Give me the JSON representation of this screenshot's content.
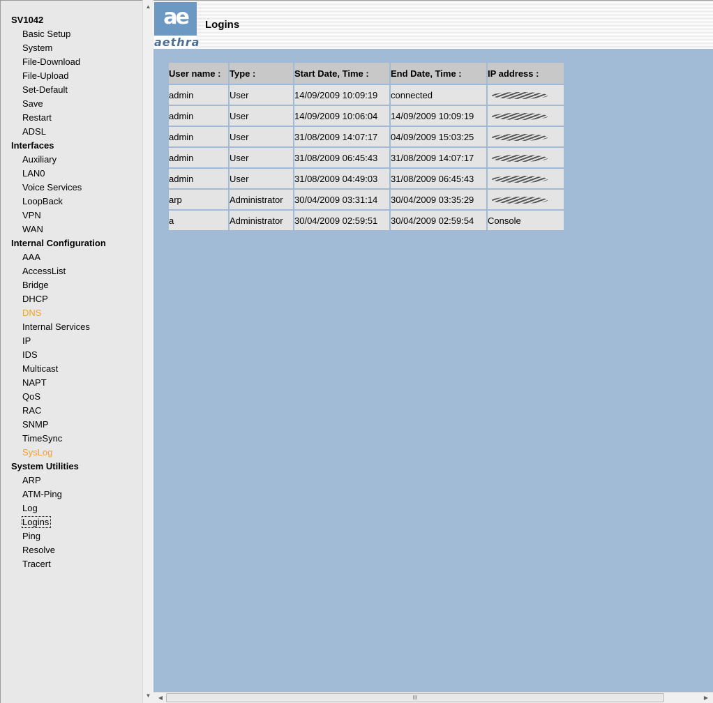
{
  "nav": {
    "groups": [
      {
        "title": "SV1042",
        "items": [
          "Basic Setup",
          "System",
          "File-Download",
          "File-Upload",
          "Set-Default",
          "Save",
          "Restart",
          "ADSL"
        ]
      },
      {
        "title": "Interfaces",
        "items": [
          "Auxiliary",
          "LAN0",
          "Voice Services",
          "LoopBack",
          "VPN",
          "WAN"
        ]
      },
      {
        "title": "Internal Configuration",
        "items": [
          "AAA",
          "AccessList",
          "Bridge",
          "DHCP",
          "DNS",
          "Internal Services",
          "IP",
          "IDS",
          "Multicast",
          "NAPT",
          "QoS",
          "RAC",
          "SNMP",
          "TimeSync",
          "SysLog"
        ]
      },
      {
        "title": "System Utilities",
        "items": [
          "ARP",
          "ATM-Ping",
          "Log",
          "Logins",
          "Ping",
          "Resolve",
          "Tracert"
        ]
      }
    ],
    "highlighted": [
      "DNS",
      "SysLog"
    ],
    "selected": "Logins",
    "highlight_color": "#f0a030"
  },
  "header": {
    "logo_mark": "ae",
    "logo_text": "aethra",
    "title": "Logins"
  },
  "logins_table": {
    "columns": [
      "User name :",
      "Type :",
      "Start Date, Time :",
      "End Date, Time :",
      "IP address :"
    ],
    "rows": [
      [
        "admin",
        "User",
        "14/09/2009 10:09:19",
        "connected",
        ""
      ],
      [
        "admin",
        "User",
        "14/09/2009 10:06:04",
        "14/09/2009 10:09:19",
        ""
      ],
      [
        "admin",
        "User",
        "31/08/2009 14:07:17",
        "04/09/2009 15:03:25",
        ""
      ],
      [
        "admin",
        "User",
        "31/08/2009 06:45:43",
        "31/08/2009 14:07:17",
        ""
      ],
      [
        "admin",
        "User",
        "31/08/2009 04:49:03",
        "31/08/2009 06:45:43",
        ""
      ],
      [
        "arp",
        "Administrator",
        "30/04/2009 03:31:14",
        "30/04/2009 03:35:29",
        ""
      ],
      [
        "a",
        "Administrator",
        "30/04/2009 02:59:51",
        "30/04/2009 02:59:54",
        "Console"
      ]
    ]
  },
  "colors": {
    "content_bg": "#a1bbd7",
    "nav_bg": "#e8e8e8",
    "logo_blue": "#6c98c4"
  },
  "scrollbars": {
    "thumb_grip": "III",
    "up_arrow": "▲",
    "down_arrow": "▼",
    "left_arrow": "◀",
    "right_arrow": "▶"
  }
}
